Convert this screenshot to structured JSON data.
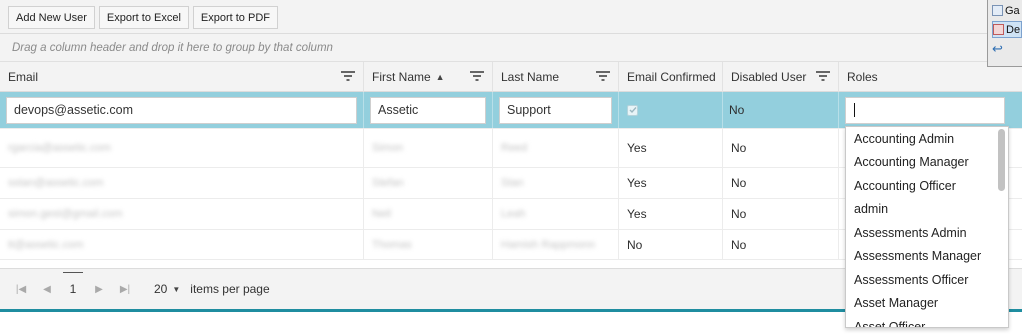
{
  "toolbar": {
    "add_new_user": "Add New User",
    "export_excel": "Export to Excel",
    "export_pdf": "Export to PDF"
  },
  "group_hint": "Drag a column header and drop it here to group by that column",
  "columns": {
    "email": "Email",
    "first_name": "First Name",
    "last_name": "Last Name",
    "email_confirmed": "Email Confirmed",
    "disabled_user": "Disabled User",
    "roles": "Roles"
  },
  "sort_indicator": "▲",
  "edit_row": {
    "email": "devops@assetic.com",
    "first_name": "Assetic",
    "last_name": "Support",
    "email_confirmed": true,
    "disabled_user": "No",
    "roles": ""
  },
  "rows": [
    {
      "email": "rgarcia@assetic.com",
      "first_name": "Simon",
      "last_name": "Reed",
      "email_confirmed": "Yes",
      "disabled_user": "No"
    },
    {
      "email": "sstan@assetic.com",
      "first_name": "Stefan",
      "last_name": "Stan",
      "email_confirmed": "Yes",
      "disabled_user": "No"
    },
    {
      "email": "simon.gest@gmail.com",
      "first_name": "Neil",
      "last_name": "Leah",
      "email_confirmed": "Yes",
      "disabled_user": "No"
    },
    {
      "email": "tt@assetic.com",
      "first_name": "Thomas",
      "last_name": "Hamish Rappmonn",
      "email_confirmed": "No",
      "disabled_user": "No"
    }
  ],
  "roles_options": [
    "Accounting Admin",
    "Accounting Manager",
    "Accounting Officer",
    "admin",
    "Assessments Admin",
    "Assessments Manager",
    "Assessments Officer",
    "Asset Manager",
    "Asset Officer"
  ],
  "pager": {
    "current_page": "1",
    "page_size": "20",
    "items_per_page_label": "items per page"
  },
  "corner_menu": [
    "Ga",
    "De",
    ""
  ],
  "colors": {
    "selected_row": "#93cfdd",
    "accent_bar": "#1f8da0"
  }
}
